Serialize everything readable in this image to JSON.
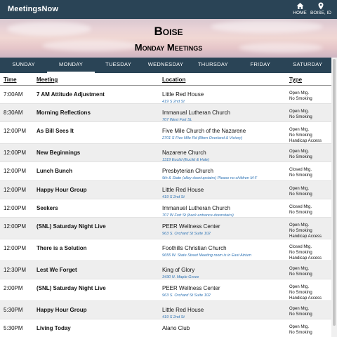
{
  "app": {
    "title": "MeetingsNow"
  },
  "nav": {
    "home": {
      "label": "HOME",
      "icon": "home-icon"
    },
    "location": {
      "label": "BOISE, ID",
      "icon": "map-pin-icon"
    }
  },
  "hero": {
    "city": "Boise",
    "subtitle": "Monday Meetings"
  },
  "days": [
    "SUNDAY",
    "MONDAY",
    "TUESDAY",
    "WEDNESDAY",
    "THURSDAY",
    "FRIDAY",
    "SATURDAY"
  ],
  "active_day": "MONDAY",
  "table": {
    "headers": {
      "time": "Time",
      "meeting": "Meeting",
      "location": "Location",
      "type": "Type"
    },
    "rows": [
      {
        "time": "7:00AM",
        "name": "7 AM Attitude Adjustment",
        "location": "Little Red House",
        "address": "419 S 2nd St",
        "type": [
          "Open Mtg.",
          "No Smoking"
        ]
      },
      {
        "time": "8:30AM",
        "name": "Morning Reflections",
        "location": "Immanual Lutheran Church",
        "address": "707 West Fort St.",
        "type": [
          "Open Mtg.",
          "No Smoking"
        ]
      },
      {
        "time": "12:00PM",
        "name": "As Bill Sees It",
        "location": "Five Mile Church of the Nazarene",
        "address": "2701 S Five Mile Rd (Btwn Overland & Victory)",
        "type": [
          "Open Mtg.",
          "No Smoking",
          "Handicap Access"
        ]
      },
      {
        "time": "12:00PM",
        "name": "New Beginnings",
        "location": "Nazarene Church",
        "address": "1319 Euclid (Euclid & Hale)",
        "type": [
          "Open Mtg.",
          "No Smoking"
        ]
      },
      {
        "time": "12:00PM",
        "name": "Lunch Bunch",
        "location": "Presbyterian Church",
        "address": "9th & State (alley door/upstairs) Please no children M-F",
        "type": [
          "Closed Mtg.",
          "No Smoking"
        ]
      },
      {
        "time": "12:00PM",
        "name": "Happy Hour Group",
        "location": "Little Red House",
        "address": "419 S 2nd St",
        "type": [
          "Open Mtg.",
          "No Smoking"
        ]
      },
      {
        "time": "12:00PM",
        "name": "Seekers",
        "location": "Immanuel Lutheran Church",
        "address": "707 W Fort St (back entrance-downstairs)",
        "type": [
          "Closed Mtg.",
          "No Smoking"
        ]
      },
      {
        "time": "12:00PM",
        "name": "(SNL) Saturday Night Live",
        "location": "PEER Wellness Center",
        "address": "963 S. Orchard St Suite 102",
        "type": [
          "Open Mtg.",
          "No Smoking",
          "Handicap Access"
        ]
      },
      {
        "time": "12:00PM",
        "name": "There is a Solution",
        "location": "Foothills Christian Church",
        "address": "9655 W. State Street Meeting room is in East Atrium",
        "type": [
          "Closed Mtg.",
          "No Smoking",
          "Handicap Access"
        ]
      },
      {
        "time": "12:30PM",
        "name": "Lest We Forget",
        "location": "King of Glory",
        "address": "3430 N. Maple Grove",
        "type": [
          "Open Mtg.",
          "No Smoking"
        ]
      },
      {
        "time": "2:00PM",
        "name": "(SNL) Saturday Night Live",
        "location": "PEER Wellness Center",
        "address": "963 S. Orchard St Suite 102",
        "type": [
          "Open Mtg.",
          "No Smoking",
          "Handicap Access"
        ]
      },
      {
        "time": "5:30PM",
        "name": "Happy Hour Group",
        "location": "Little Red House",
        "address": "419 S 2nd St",
        "type": [
          "Open Mtg.",
          "No Smoking"
        ]
      },
      {
        "time": "5:30PM",
        "name": "Living Today",
        "location": "Alano Club",
        "address": "",
        "type": [
          "Open Mtg.",
          "No Smoking"
        ]
      }
    ]
  },
  "colors": {
    "header_bg": "#2a4456",
    "address_link": "#2f74b5",
    "alt_row": "#eeeeee"
  }
}
